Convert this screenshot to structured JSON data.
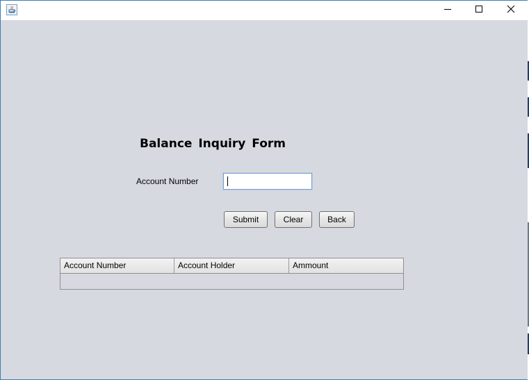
{
  "window": {
    "title": "",
    "controls": {
      "minimize_icon": "minimize-icon",
      "maximize_icon": "maximize-icon",
      "close_icon": "close-icon"
    }
  },
  "form": {
    "title": "Balance  Inquiry  Form",
    "account_number_label": "Account Number",
    "account_number_value": "",
    "buttons": {
      "submit": "Submit",
      "clear": "Clear",
      "back": "Back"
    }
  },
  "table": {
    "columns": [
      "Account Number",
      "Account Holder",
      "Ammount"
    ],
    "rows": []
  },
  "colors": {
    "background": "#d6d9df",
    "window_border": "#3c7fb1",
    "input_focus_border": "#7a9cc6"
  }
}
